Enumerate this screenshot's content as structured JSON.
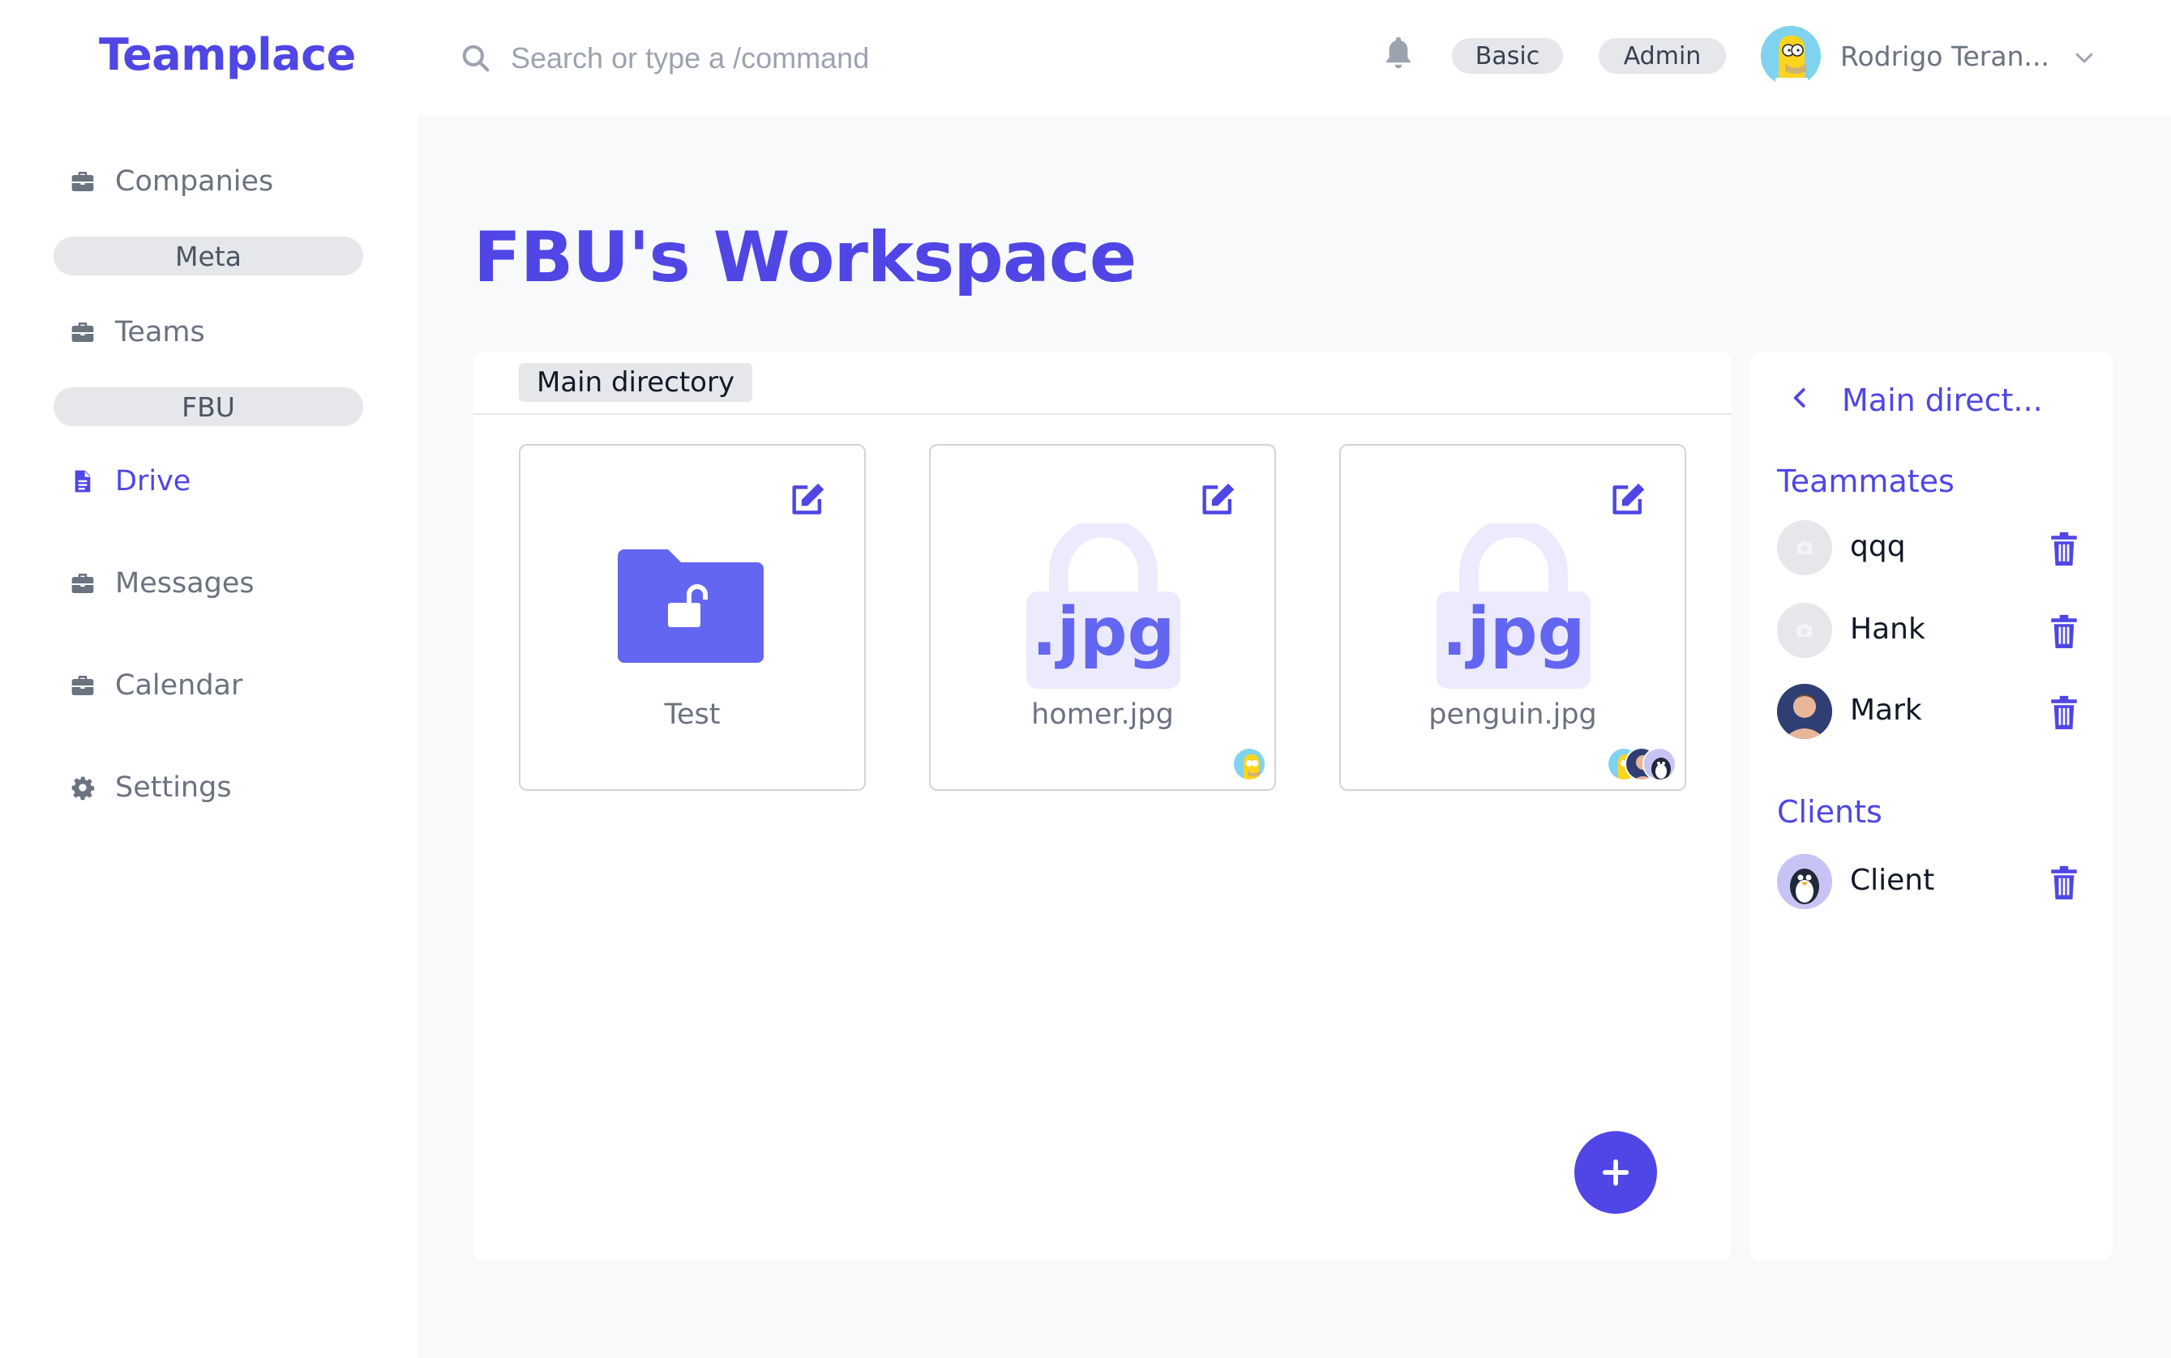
{
  "app": {
    "logo": "Teamplace"
  },
  "header": {
    "search_placeholder": "Search or type a /command",
    "role_badges": [
      "Basic",
      "Admin"
    ],
    "user_name": "Rodrigo Teran..."
  },
  "sidebar": {
    "items": [
      {
        "label": "Companies",
        "icon": "briefcase-icon"
      },
      {
        "label": "Teams",
        "icon": "briefcase-icon"
      },
      {
        "label": "Drive",
        "icon": "document-icon",
        "active": true
      },
      {
        "label": "Messages",
        "icon": "briefcase-icon"
      },
      {
        "label": "Calendar",
        "icon": "briefcase-icon"
      },
      {
        "label": "Settings",
        "icon": "gear-icon"
      }
    ],
    "company_pill": "Meta",
    "team_pill": "FBU"
  },
  "main": {
    "title": "FBU's Workspace",
    "directory_tab": "Main directory",
    "files": [
      {
        "name": "Test",
        "type": "folder"
      },
      {
        "name": "homer.jpg",
        "type": "jpg"
      },
      {
        "name": "penguin.jpg",
        "type": "jpg"
      }
    ],
    "file_ext_label": ".jpg"
  },
  "right_panel": {
    "title": "Main direct...",
    "teammates_heading": "Teammates",
    "teammates": [
      "qqq",
      "Hank",
      "Mark"
    ],
    "clients_heading": "Clients",
    "clients": [
      "Client"
    ]
  },
  "colors": {
    "accent": "#4f46e5",
    "folder": "#6366f1",
    "jpg_bg": "#eceafd"
  }
}
